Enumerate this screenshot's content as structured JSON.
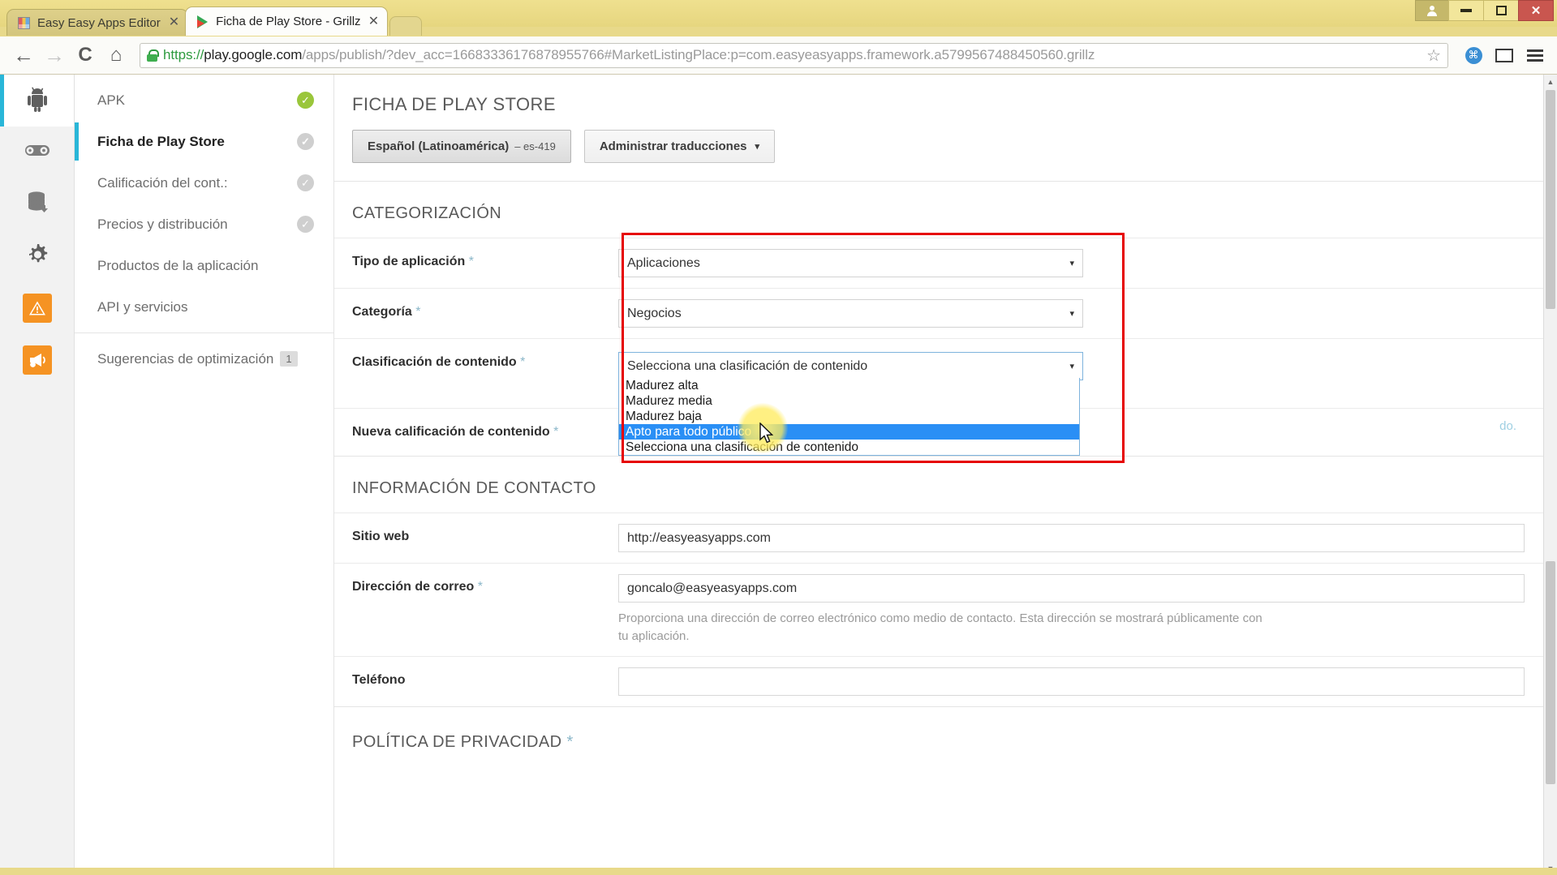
{
  "window": {
    "controls": {
      "user": "user-icon",
      "minimize": "minimize",
      "maximize": "maximize",
      "close": "✕"
    }
  },
  "tabs": [
    {
      "title": "Easy Easy Apps Editor",
      "favicon": "grid-favicon",
      "active": false,
      "close": "✕"
    },
    {
      "title": "Ficha de Play Store - Grillz",
      "favicon": "play-store-favicon",
      "active": true,
      "close": "✕"
    }
  ],
  "toolbar": {
    "back": "←",
    "forward": "→",
    "reload": "C",
    "home": "⌂",
    "url_scheme": "https://",
    "url_host": "play.google.com",
    "url_path": "/apps/publish/?dev_acc=16683336176878955766#MarketListingPlace:p=com.easyeasyapps.framework.a5799567488450560.grillz",
    "star": "☆",
    "extension": "⌘",
    "cast": "cast-icon",
    "menu": "hamburger-icon"
  },
  "rail": [
    {
      "name": "android-icon",
      "glyph": "🤖",
      "active": true
    },
    {
      "name": "gamepad-icon",
      "glyph": "🎮",
      "active": false
    },
    {
      "name": "database-icon",
      "glyph": "🗄",
      "active": false
    },
    {
      "name": "gear-icon",
      "glyph": "⚙",
      "active": false
    },
    {
      "name": "alert-icon",
      "glyph": "⚠",
      "active": false
    },
    {
      "name": "megaphone-icon",
      "glyph": "📢",
      "active": false
    }
  ],
  "nav": {
    "items": [
      {
        "label": "APK",
        "status": "done",
        "active": false
      },
      {
        "label": "Ficha de Play Store",
        "status": "pending",
        "active": true
      },
      {
        "label": "Calificación del cont.:",
        "status": "pending",
        "active": false
      },
      {
        "label": "Precios y distribución",
        "status": "pending",
        "active": false
      },
      {
        "label": "Productos de la aplicación",
        "status": "none",
        "active": false
      },
      {
        "label": "API y servicios",
        "status": "none",
        "active": false
      }
    ],
    "suggestions": {
      "label": "Sugerencias de optimización",
      "badge": "1"
    }
  },
  "main": {
    "page_title": "FICHA DE PLAY STORE",
    "language_button": {
      "label": "Español (Latinoamérica)",
      "code": "– es-419"
    },
    "translations_button": {
      "label": "Administrar traducciones",
      "caret": "▾"
    },
    "categorization": {
      "heading": "CATEGORIZACIÓN",
      "rows": [
        {
          "label": "Tipo de aplicación",
          "required": "*",
          "value": "Aplicaciones",
          "caret": "▾"
        },
        {
          "label": "Categoría",
          "required": "*",
          "value": "Negocios",
          "caret": "▾"
        },
        {
          "label": "Clasificación de contenido",
          "required": "*",
          "value": "Selecciona una clasificación de contenido",
          "caret": "▾"
        },
        {
          "label": "Nueva calificación de contenido",
          "required": "*",
          "value": "",
          "tail_text": "do."
        }
      ],
      "dropdown_options": [
        {
          "label": "Madurez alta",
          "selected": false
        },
        {
          "label": "Madurez media",
          "selected": false
        },
        {
          "label": "Madurez baja",
          "selected": false
        },
        {
          "label": "Apto para todo público",
          "selected": true
        },
        {
          "label": "Selecciona una clasificación de contenido",
          "selected": false
        }
      ]
    },
    "contact": {
      "heading": "INFORMACIÓN DE CONTACTO",
      "website": {
        "label": "Sitio web",
        "required": "",
        "value": "http://easyeasyapps.com"
      },
      "email": {
        "label": "Dirección de correo",
        "required": "*",
        "value": "goncalo@easyeasyapps.com",
        "hint": "Proporciona una dirección de correo electrónico como medio de contacto. Esta dirección se mostrará públicamente con tu aplicación."
      },
      "phone": {
        "label": "Teléfono",
        "required": "",
        "value": ""
      }
    },
    "privacy": {
      "heading": "POLÍTICA DE PRIVACIDAD",
      "required": "*"
    }
  },
  "scrollbar": {
    "up": "▲",
    "down": "▼"
  },
  "colors": {
    "accent_teal": "#29b6d8",
    "done_green": "#9ac63b",
    "orange": "#f59323",
    "annotation_red": "#e60000",
    "highlight_blue": "#2a8ff5",
    "chrome_yellow": "#e8d98a"
  }
}
